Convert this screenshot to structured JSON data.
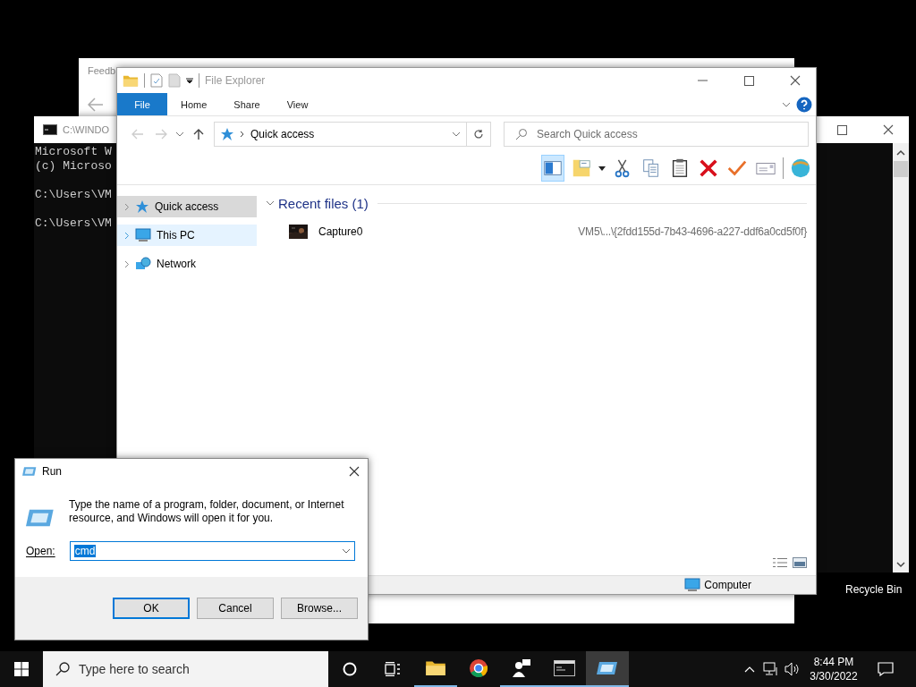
{
  "feedback_window": {
    "title": "Feedb"
  },
  "console_window": {
    "title": "C:\\WINDO",
    "blocks": [
      [
        "Microsoft W",
        "(c) Microso"
      ],
      [
        "C:\\Users\\VM"
      ],
      [
        "C:\\Users\\VM"
      ]
    ]
  },
  "file_explorer": {
    "title": "File Explorer",
    "ribbon_tabs": [
      {
        "label": "File",
        "selected": true
      },
      {
        "label": "Home",
        "selected": false
      },
      {
        "label": "Share",
        "selected": false
      },
      {
        "label": "View",
        "selected": false
      }
    ],
    "address": "Quick access",
    "search": {
      "placeholder": "Search Quick access"
    },
    "toolbar": [
      {
        "kind": "pane",
        "selected": true
      },
      {
        "kind": "note",
        "selected": false
      },
      {
        "kind": "cut",
        "selected": false
      },
      {
        "kind": "copy",
        "selected": false
      },
      {
        "kind": "paste",
        "selected": false
      },
      {
        "kind": "delete",
        "selected": false
      },
      {
        "kind": "check",
        "selected": false
      },
      {
        "kind": "mail",
        "selected": false
      },
      {
        "kind": "globe",
        "selected": false
      }
    ],
    "navigation": [
      {
        "label": "Quick access",
        "kind": "star",
        "selected": true,
        "hovered": false
      },
      {
        "label": "This PC",
        "kind": "pc",
        "selected": false,
        "hovered": true
      },
      {
        "label": "Network",
        "kind": "network",
        "selected": false,
        "hovered": false
      }
    ],
    "section": {
      "title": "Recent files (1)",
      "expanded": true
    },
    "files": [
      {
        "name": "Capture0",
        "path": "VM5\\...\\{2fdd155d-7b43-4696-a227-ddf6a0cd5f0f}"
      }
    ],
    "status_bar": "Computer"
  },
  "run_dialog": {
    "title": "Run",
    "message": "Type the name of a program, folder, document, or Internet resource, and Windows will open it for you.",
    "open_label": "Open:",
    "value": "cmd",
    "value_selected": true,
    "buttons": [
      {
        "label": "OK",
        "default": true
      },
      {
        "label": "Cancel",
        "default": false
      },
      {
        "label": "Browse...",
        "default": false
      }
    ]
  },
  "desktop_icons": [
    {
      "label": "Recycle Bin"
    }
  ],
  "taskbar": {
    "search": {
      "placeholder": "Type here to search"
    },
    "apps": [
      {
        "kind": "explorer",
        "running": true,
        "active": false
      },
      {
        "kind": "chrome",
        "running": false,
        "active": false
      },
      {
        "kind": "people",
        "running": true,
        "active": false
      },
      {
        "kind": "console",
        "running": true,
        "active": false
      },
      {
        "kind": "run",
        "running": true,
        "active": true
      }
    ],
    "time": "8:44 PM",
    "date": "3/30/2022"
  }
}
